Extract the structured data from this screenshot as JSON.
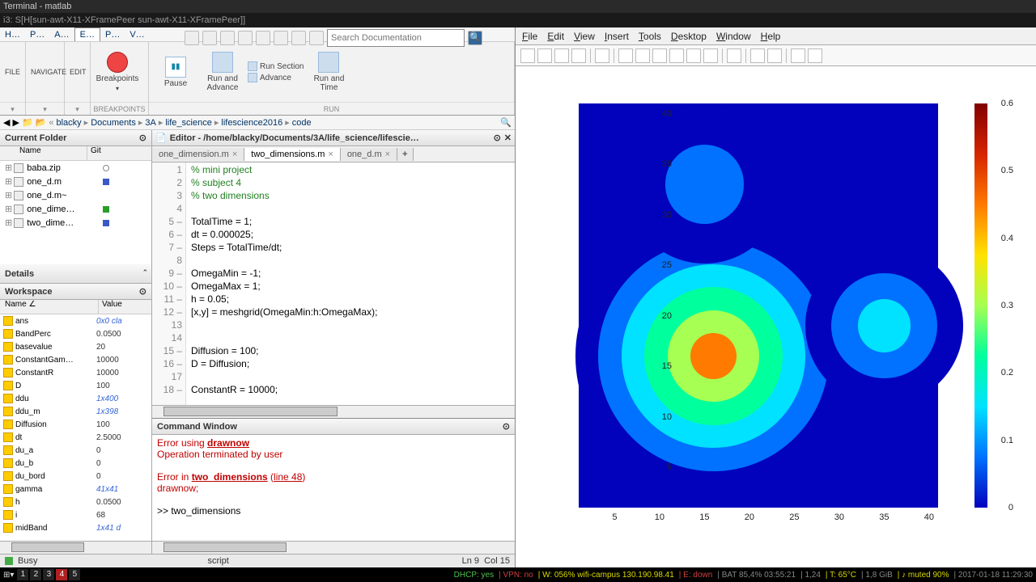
{
  "title": "Terminal - matlab",
  "tabline": "i3: S[H[sun-awt-X11-XFramePeer sun-awt-X11-XFramePeer]]",
  "ribbon_tabs": [
    "H…",
    "P…",
    "A…",
    "E…",
    "P…",
    "V…"
  ],
  "search_placeholder": "Search Documentation",
  "ribbon": {
    "file": "FILE",
    "navigate": "NAVIGATE",
    "edit": "EDIT",
    "bp_group": "BREAKPOINTS",
    "bp": "Breakpoints",
    "pause": "Pause",
    "run_adv": "Run and\nAdvance",
    "run_section": "Run Section",
    "advance": "Advance",
    "run_group": "RUN",
    "run_time": "Run and\nTime"
  },
  "path": [
    "blacky",
    "Documents",
    "3A",
    "life_science",
    "lifescience2016",
    "code"
  ],
  "cf_title": "Current Folder",
  "cf_cols": {
    "name": "Name",
    "git": "Git"
  },
  "files": [
    {
      "n": "baba.zip",
      "g": "circ"
    },
    {
      "n": "one_d.m",
      "g": "blue"
    },
    {
      "n": "one_d.m~",
      "g": ""
    },
    {
      "n": "one_dime…",
      "g": "green"
    },
    {
      "n": "two_dime…",
      "g": "blue"
    }
  ],
  "details_title": "Details",
  "ws_title": "Workspace",
  "ws_cols": {
    "name": "Name ∠",
    "val": "Value"
  },
  "ws": [
    {
      "n": "ans",
      "v": "0x0 cla",
      "it": 1
    },
    {
      "n": "BandPerc",
      "v": "0.0500"
    },
    {
      "n": "basevalue",
      "v": "20"
    },
    {
      "n": "ConstantGam…",
      "v": "10000"
    },
    {
      "n": "ConstantR",
      "v": "10000"
    },
    {
      "n": "D",
      "v": "100"
    },
    {
      "n": "ddu",
      "v": "1x400",
      "it": 1
    },
    {
      "n": "ddu_m",
      "v": "1x398",
      "it": 1
    },
    {
      "n": "Diffusion",
      "v": "100"
    },
    {
      "n": "dt",
      "v": "2.5000"
    },
    {
      "n": "du_a",
      "v": "0"
    },
    {
      "n": "du_b",
      "v": "0"
    },
    {
      "n": "du_bord",
      "v": "0"
    },
    {
      "n": "gamma",
      "v": "41x41",
      "it": 1
    },
    {
      "n": "h",
      "v": "0.0500"
    },
    {
      "n": "i",
      "v": "68"
    },
    {
      "n": "midBand",
      "v": "1x41 d",
      "it": 1
    }
  ],
  "editor_title": "Editor - /home/blacky/Documents/3A/life_science/lifescie…",
  "ed_tabs": [
    {
      "l": "one_dimension.m",
      "a": 0
    },
    {
      "l": "two_dimensions.m",
      "a": 1
    },
    {
      "l": "one_d.m",
      "a": 0
    }
  ],
  "code": [
    {
      "ln": "1",
      "t": "% mini project",
      "c": "cmt"
    },
    {
      "ln": "2",
      "t": "% subject 4",
      "c": "cmt"
    },
    {
      "ln": "3",
      "t": "% two dimensions",
      "c": "cmt"
    },
    {
      "ln": "4",
      "t": ""
    },
    {
      "ln": "5 –",
      "t": "TotalTime = 1;"
    },
    {
      "ln": "6 –",
      "t": "dt = 0.000025;"
    },
    {
      "ln": "7 –",
      "t": "Steps = TotalTime/dt;"
    },
    {
      "ln": "8",
      "t": ""
    },
    {
      "ln": "9 –",
      "t": "OmegaMin = -1;"
    },
    {
      "ln": "10 –",
      "t": "OmegaMax = 1;"
    },
    {
      "ln": "11 –",
      "t": "h = 0.05;"
    },
    {
      "ln": "12 –",
      "t": "[x,y] = meshgrid(OmegaMin:h:OmegaMax);"
    },
    {
      "ln": "13",
      "t": ""
    },
    {
      "ln": "14",
      "t": ""
    },
    {
      "ln": "15 –",
      "t": "Diffusion = 100;"
    },
    {
      "ln": "16 –",
      "t": "D = Diffusion;"
    },
    {
      "ln": "17",
      "t": ""
    },
    {
      "ln": "18 –",
      "t": "ConstantR = 10000;"
    }
  ],
  "cmd_title": "Command Window",
  "cmd_lines": [
    {
      "pre": "Error using ",
      "link": "drawnow",
      "post": ""
    },
    {
      "plain": "Operation terminated by user"
    },
    {
      "blank": 1
    },
    {
      "pre": "Error in ",
      "link": "two_dimensions",
      "post2": " (",
      "link2": "line 48",
      "post3": ")"
    },
    {
      "plain": "    drawnow;"
    },
    {
      "blank": 1
    },
    {
      "prompt": ">> two_dimensions"
    }
  ],
  "status": {
    "busy": "Busy",
    "script": "script",
    "ln": "Ln",
    "lnv": "9",
    "col": "Col",
    "colv": "15"
  },
  "figmenu": [
    "File",
    "Edit",
    "View",
    "Insert",
    "Tools",
    "Desktop",
    "Window",
    "Help"
  ],
  "chart_data": {
    "type": "heatmap",
    "title": "",
    "xlim": [
      1,
      41
    ],
    "ylim": [
      1,
      41
    ],
    "clim": [
      0,
      0.6
    ],
    "xticks": [
      5,
      10,
      15,
      20,
      25,
      30,
      35,
      40
    ],
    "yticks": [
      5,
      10,
      15,
      20,
      25,
      30,
      35,
      40
    ],
    "cticks": [
      0,
      0.1,
      0.2,
      0.3,
      0.4,
      0.5,
      0.6
    ],
    "colormap": "jet",
    "peaks": [
      {
        "cx": 16,
        "cy": 16,
        "amp": 0.6,
        "r": 7
      },
      {
        "cx": 35,
        "cy": 19,
        "amp": 0.32,
        "r": 4
      },
      {
        "cx": 15,
        "cy": 33,
        "amp": 0.2,
        "r": 4
      },
      {
        "cx": 36,
        "cy": 30,
        "amp": 0.05,
        "r": 1
      }
    ]
  },
  "i3": {
    "workspaces": [
      "1",
      "2",
      "3",
      "4",
      "5"
    ],
    "active": 3,
    "segs": [
      "DHCP: yes",
      "VPN: no",
      "W: 056% wifi-campus 130.190.98.41",
      "E: down",
      "BAT 85,4% 03:55:21",
      "1,24",
      "T: 65°C",
      "1,8 GiB",
      "♪ muted 90%",
      "2017-01-18 11:29:30"
    ]
  }
}
